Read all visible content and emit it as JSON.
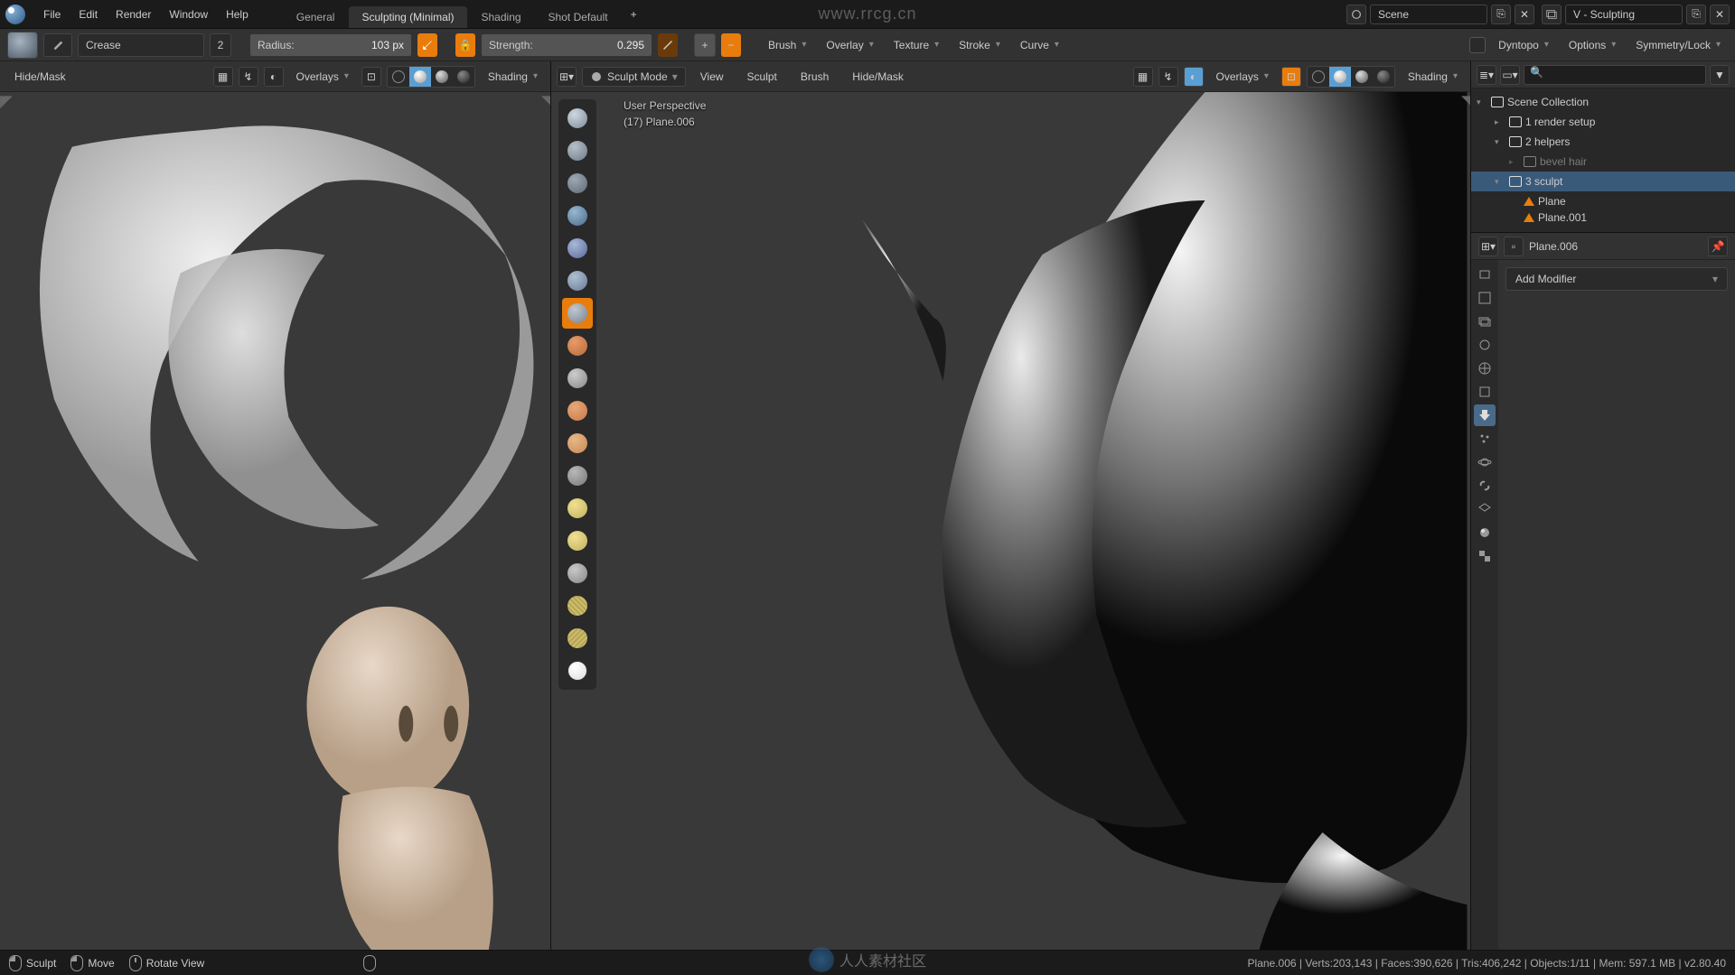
{
  "topbar": {
    "menus": [
      "File",
      "Edit",
      "Render",
      "Window",
      "Help"
    ],
    "tabs": [
      "General",
      "Sculpting (Minimal)",
      "Shading",
      "Shot Default"
    ],
    "active_tab": 1,
    "watermark": "www.rrcg.cn",
    "scene_name": "Scene",
    "viewlayer_name": "V - Sculpting"
  },
  "toolsettings": {
    "brush_name": "Crease",
    "radius_label": "Radius:",
    "radius_value": "103 px",
    "strength_label": "Strength:",
    "strength_value": "0.295",
    "dropdowns": [
      "Brush",
      "Overlay",
      "Texture",
      "Stroke",
      "Curve"
    ],
    "right": [
      "Dyntopo",
      "Options",
      "Symmetry/Lock"
    ]
  },
  "vp_left": {
    "header": {
      "hidemask": "Hide/Mask",
      "overlays": "Overlays",
      "shading": "Shading"
    }
  },
  "vp_right": {
    "header": {
      "mode": "Sculpt Mode",
      "menus": [
        "View",
        "Sculpt",
        "Brush",
        "Hide/Mask"
      ],
      "overlays": "Overlays",
      "shading": "Shading"
    },
    "overlay_l1": "User Perspective",
    "overlay_l2": "(17) Plane.006"
  },
  "outliner": {
    "root": "Scene Collection",
    "items": [
      {
        "name": "1 render setup",
        "indent": 1,
        "expanded": false
      },
      {
        "name": "2 helpers",
        "indent": 1,
        "expanded": true
      },
      {
        "name": "bevel hair",
        "indent": 2,
        "expanded": false,
        "dim": true
      },
      {
        "name": "3 sculpt",
        "indent": 1,
        "expanded": true,
        "selected": true
      },
      {
        "name": "Plane",
        "indent": 2,
        "mesh": true
      },
      {
        "name": "Plane.001",
        "indent": 2,
        "mesh": true,
        "cut": true
      }
    ]
  },
  "properties": {
    "object_label": "Plane.006",
    "add_modifier": "Add Modifier"
  },
  "statusbar": {
    "left": [
      {
        "icon": "left",
        "label": "Sculpt"
      },
      {
        "icon": "left",
        "label": "Move"
      },
      {
        "icon": "mid",
        "label": "Rotate View"
      }
    ],
    "right": "Plane.006 | Verts:203,143 | Faces:390,626 | Tris:406,242 | Objects:1/11 | Mem: 597.1 MB | v2.80.40"
  },
  "footer_brand": "人人素材社区"
}
